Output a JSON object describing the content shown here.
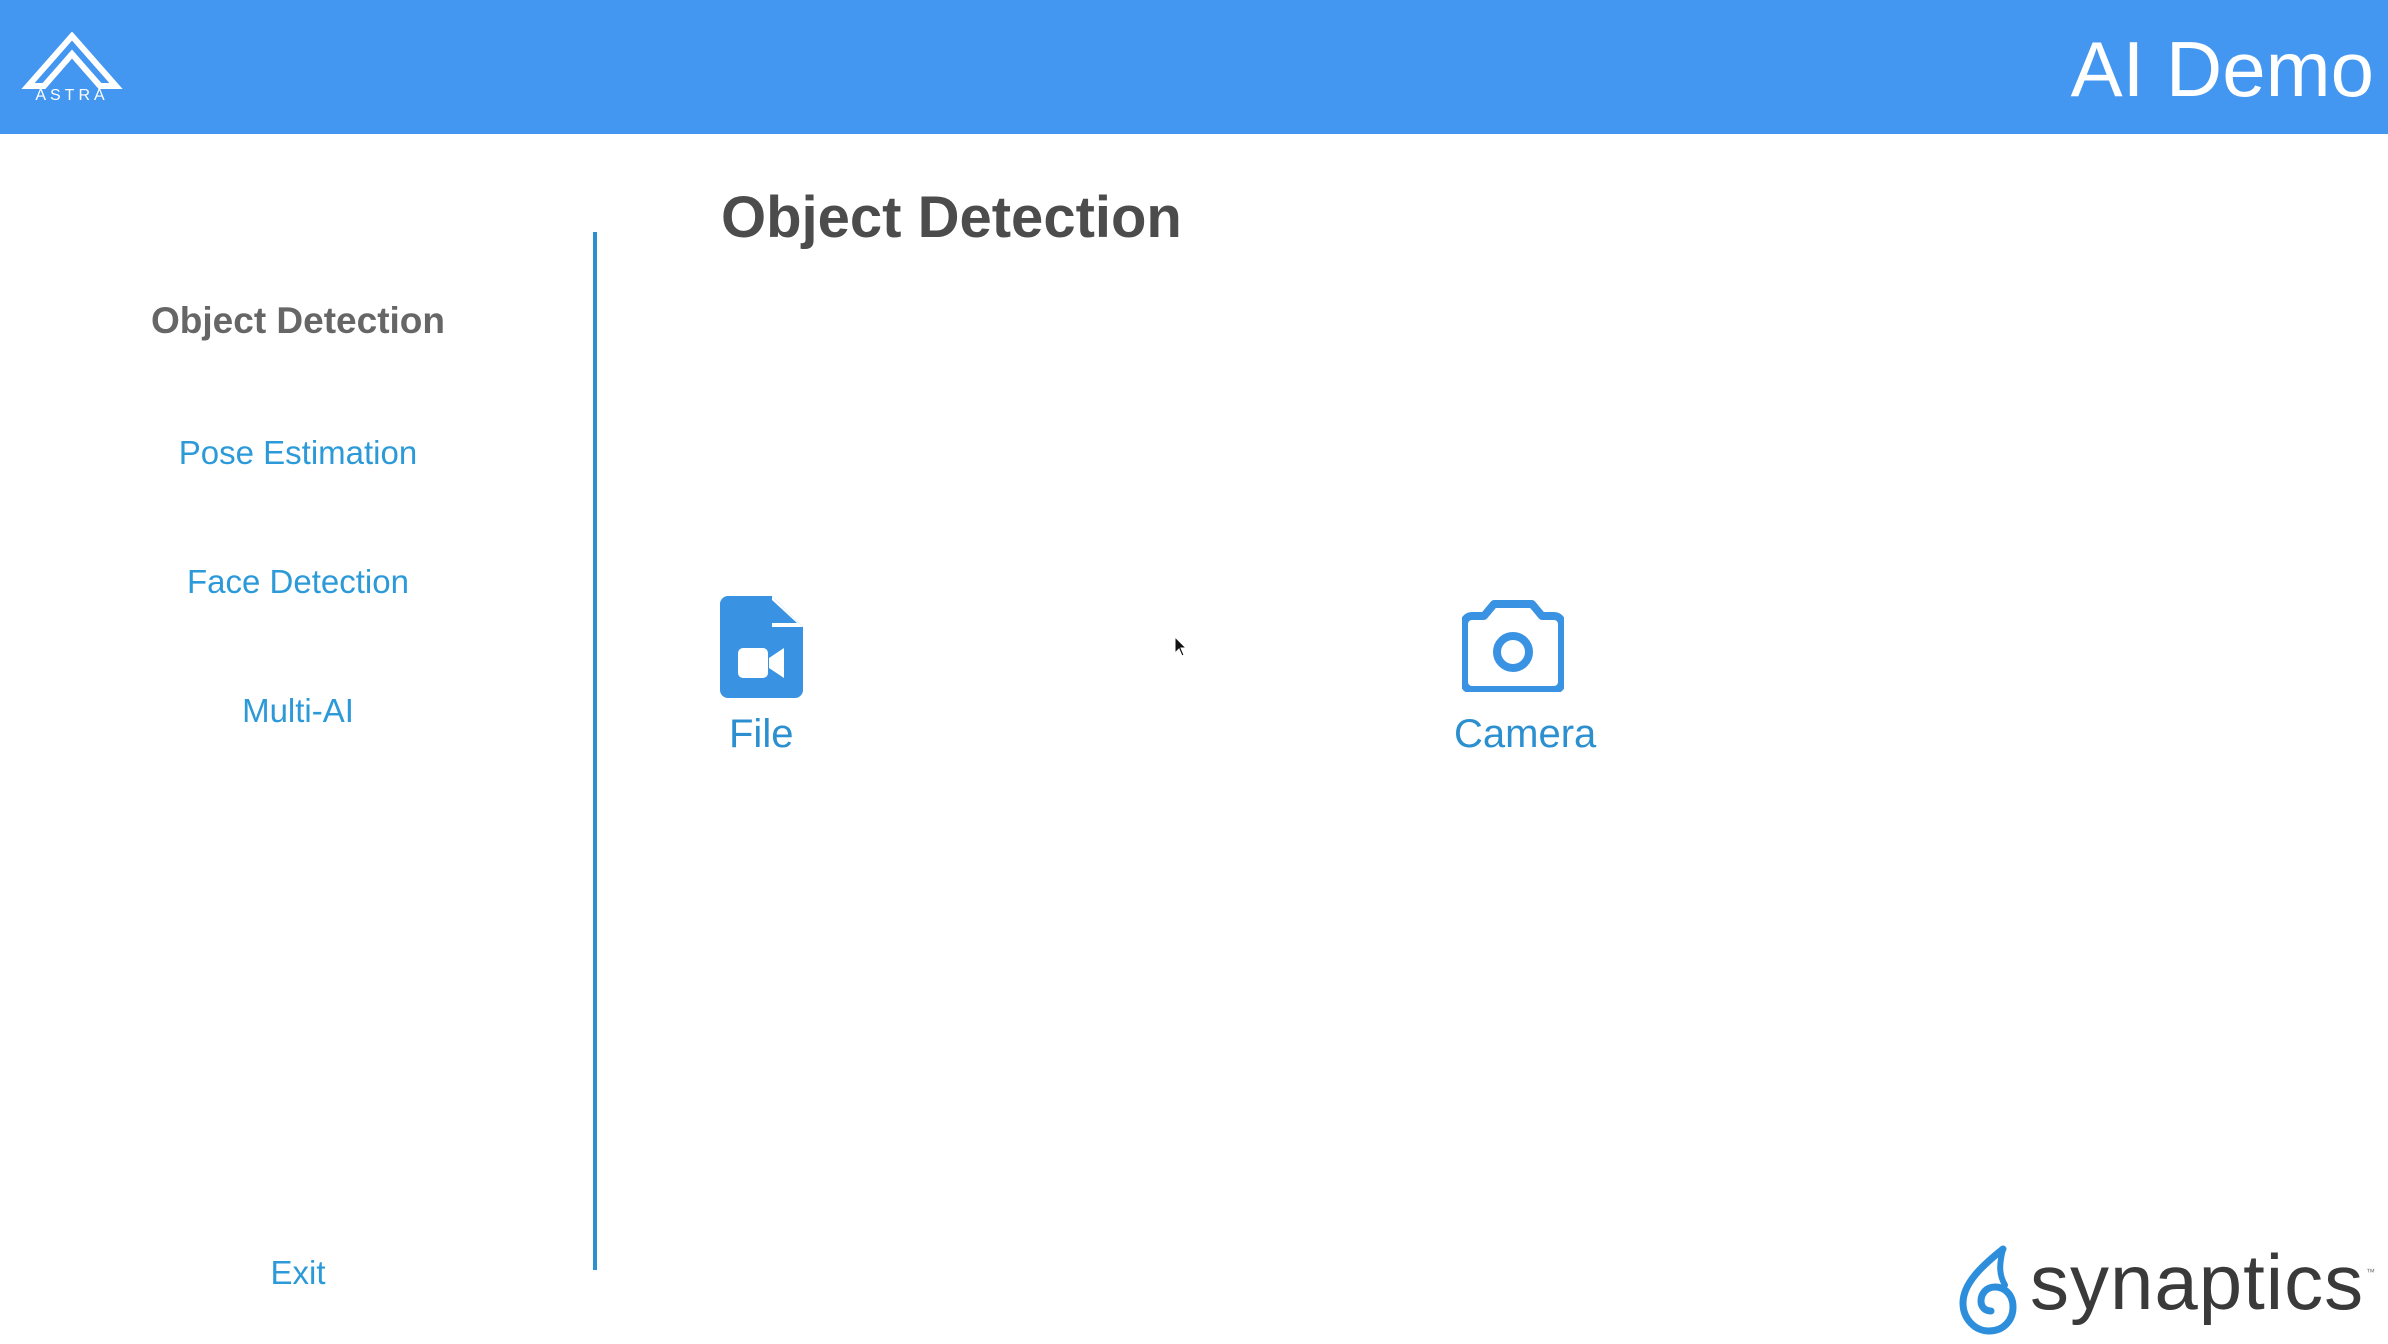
{
  "header": {
    "logo_text": "ASTRA",
    "title": "AI Demo"
  },
  "sidebar": {
    "items": [
      {
        "label": "Object Detection",
        "active": true
      },
      {
        "label": "Pose Estimation",
        "active": false
      },
      {
        "label": "Face Detection",
        "active": false
      },
      {
        "label": "Multi-AI",
        "active": false
      }
    ],
    "exit_label": "Exit"
  },
  "main": {
    "title": "Object Detection",
    "sources": [
      {
        "label": "File",
        "icon": "video-file-icon"
      },
      {
        "label": "Camera",
        "icon": "camera-icon"
      }
    ]
  },
  "footer": {
    "brand_text": "synaptics"
  },
  "colors": {
    "header_bg": "#4497f0",
    "accent": "#2c9ad8",
    "active_text": "#666666",
    "title_text": "#4c4c4c"
  }
}
